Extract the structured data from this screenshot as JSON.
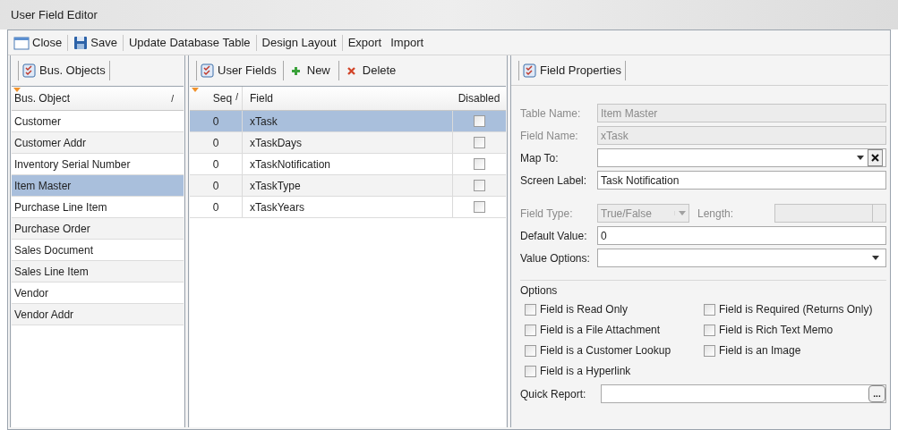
{
  "window": {
    "title": "User Field Editor"
  },
  "toolbar": [
    {
      "label": "Close"
    },
    {
      "label": "Save"
    },
    {
      "label": "Update Database Table"
    },
    {
      "label": "Design Layout"
    },
    {
      "label": "Export"
    },
    {
      "label": "Import"
    }
  ],
  "bus_objects": {
    "tab": "Bus. Objects",
    "column": "Bus. Object",
    "sort_mark": "/",
    "rows": [
      {
        "label": "Customer",
        "selected": false
      },
      {
        "label": "Customer Addr",
        "selected": false
      },
      {
        "label": "Inventory Serial Number",
        "selected": false
      },
      {
        "label": "Item Master",
        "selected": true
      },
      {
        "label": "Purchase Line Item",
        "selected": false
      },
      {
        "label": "Purchase Order",
        "selected": false
      },
      {
        "label": "Sales Document",
        "selected": false
      },
      {
        "label": "Sales Line Item",
        "selected": false
      },
      {
        "label": "Vendor",
        "selected": false
      },
      {
        "label": "Vendor Addr",
        "selected": false
      }
    ]
  },
  "user_fields": {
    "tab": "User Fields",
    "actions": [
      {
        "label": "New"
      },
      {
        "label": "Delete"
      }
    ],
    "columns": [
      "Seq",
      "Field",
      "Disabled"
    ],
    "sort_mark": "/",
    "rows": [
      {
        "seq": "0",
        "field": "xTask",
        "disabled": false,
        "selected": true
      },
      {
        "seq": "0",
        "field": "xTaskDays",
        "disabled": false,
        "selected": false
      },
      {
        "seq": "0",
        "field": "xTaskNotification",
        "disabled": false,
        "selected": false
      },
      {
        "seq": "0",
        "field": "xTaskType",
        "disabled": false,
        "selected": false
      },
      {
        "seq": "0",
        "field": "xTaskYears",
        "disabled": false,
        "selected": false
      }
    ]
  },
  "field_properties": {
    "tab": "Field Properties",
    "fields": [
      {
        "kind": "text",
        "label": "Table Name:",
        "value": "Item Master",
        "disabled": true
      },
      {
        "kind": "text",
        "label": "Field Name:",
        "value": "xTask",
        "disabled": true
      },
      {
        "kind": "combo_clear",
        "label": "Map To:",
        "disabled": false
      },
      {
        "kind": "text",
        "label": "Screen Label:",
        "value": "Task Notification",
        "disabled": false
      },
      {
        "kind": "type_length",
        "label": "Field Type:",
        "value": "True/False",
        "label_2": "Length:",
        "disabled": true
      },
      {
        "kind": "text",
        "label": "Default Value:",
        "value": "0",
        "disabled": false
      },
      {
        "kind": "combo",
        "label": "Value Options:",
        "disabled": false
      }
    ],
    "options_title": "Options",
    "options": [
      {
        "label": "Field is Read Only",
        "checked": false
      },
      {
        "label": "Field is Required (Returns Only)",
        "checked": false
      },
      {
        "label": "Field is a File Attachment",
        "checked": false
      },
      {
        "label": "Field is Rich Text Memo",
        "checked": false
      },
      {
        "label": "Field is a Customer Lookup",
        "checked": false
      },
      {
        "label": "Field is an Image",
        "checked": false
      },
      {
        "label": "Field is a Hyperlink",
        "checked": false
      }
    ],
    "quick_report": {
      "label": "Quick Report:",
      "button": "..."
    }
  }
}
